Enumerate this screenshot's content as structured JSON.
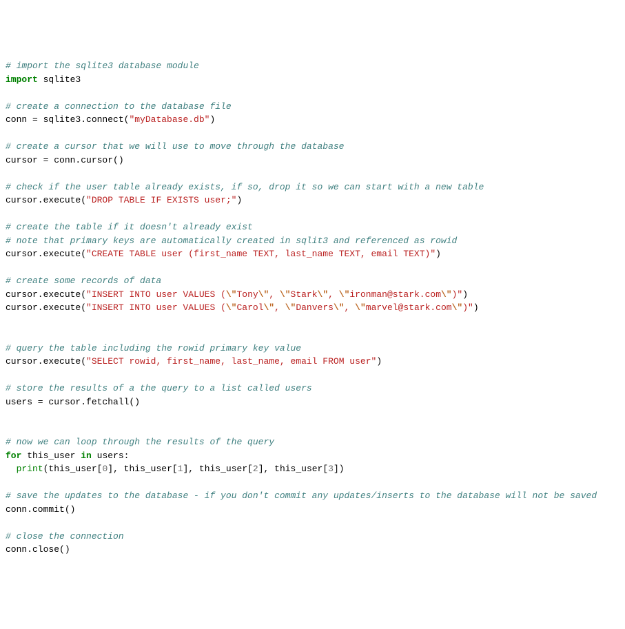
{
  "code": {
    "lines": [
      {
        "type": "comment",
        "text": "# import the sqlite3 database module"
      },
      {
        "type": "code",
        "tokens": [
          {
            "t": "keyword",
            "v": "import"
          },
          {
            "t": "name",
            "v": " sqlite3"
          }
        ]
      },
      {
        "type": "blank"
      },
      {
        "type": "comment",
        "text": "# create a connection to the database file"
      },
      {
        "type": "code",
        "tokens": [
          {
            "t": "name",
            "v": "conn = sqlite3.connect("
          },
          {
            "t": "string",
            "v": "\"myDatabase.db\""
          },
          {
            "t": "name",
            "v": ")"
          }
        ]
      },
      {
        "type": "blank"
      },
      {
        "type": "comment",
        "text": "# create a cursor that we will use to move through the database"
      },
      {
        "type": "code",
        "tokens": [
          {
            "t": "name",
            "v": "cursor = conn.cursor()"
          }
        ]
      },
      {
        "type": "blank"
      },
      {
        "type": "comment",
        "text": "# check if the user table already exists, if so, drop it so we can start with a new table"
      },
      {
        "type": "code",
        "tokens": [
          {
            "t": "name",
            "v": "cursor.execute("
          },
          {
            "t": "string",
            "v": "\"DROP TABLE IF EXISTS user;\""
          },
          {
            "t": "name",
            "v": ")"
          }
        ]
      },
      {
        "type": "blank"
      },
      {
        "type": "comment",
        "text": "# create the table if it doesn't already exist"
      },
      {
        "type": "comment",
        "text": "# note that primary keys are automatically created in sqlit3 and referenced as rowid"
      },
      {
        "type": "code",
        "tokens": [
          {
            "t": "name",
            "v": "cursor.execute("
          },
          {
            "t": "string",
            "v": "\"CREATE TABLE user (first_name TEXT, last_name TEXT, email TEXT)\""
          },
          {
            "t": "name",
            "v": ")"
          }
        ]
      },
      {
        "type": "blank"
      },
      {
        "type": "comment",
        "text": "# create some records of data"
      },
      {
        "type": "code",
        "tokens": [
          {
            "t": "name",
            "v": "cursor.execute("
          },
          {
            "t": "string",
            "v": "\"INSERT INTO user VALUES ("
          },
          {
            "t": "escape",
            "v": "\\\""
          },
          {
            "t": "string",
            "v": "Tony"
          },
          {
            "t": "escape",
            "v": "\\\""
          },
          {
            "t": "string",
            "v": ", "
          },
          {
            "t": "escape",
            "v": "\\\""
          },
          {
            "t": "string",
            "v": "Stark"
          },
          {
            "t": "escape",
            "v": "\\\""
          },
          {
            "t": "string",
            "v": ", "
          },
          {
            "t": "escape",
            "v": "\\\""
          },
          {
            "t": "string",
            "v": "ironman@stark.com"
          },
          {
            "t": "escape",
            "v": "\\\""
          },
          {
            "t": "string",
            "v": ")\""
          },
          {
            "t": "name",
            "v": ")"
          }
        ]
      },
      {
        "type": "code",
        "tokens": [
          {
            "t": "name",
            "v": "cursor.execute("
          },
          {
            "t": "string",
            "v": "\"INSERT INTO user VALUES ("
          },
          {
            "t": "escape",
            "v": "\\\""
          },
          {
            "t": "string",
            "v": "Carol"
          },
          {
            "t": "escape",
            "v": "\\\""
          },
          {
            "t": "string",
            "v": ", "
          },
          {
            "t": "escape",
            "v": "\\\""
          },
          {
            "t": "string",
            "v": "Danvers"
          },
          {
            "t": "escape",
            "v": "\\\""
          },
          {
            "t": "string",
            "v": ", "
          },
          {
            "t": "escape",
            "v": "\\\""
          },
          {
            "t": "string",
            "v": "marvel@stark.com"
          },
          {
            "t": "escape",
            "v": "\\\""
          },
          {
            "t": "string",
            "v": ")\""
          },
          {
            "t": "name",
            "v": ")"
          }
        ]
      },
      {
        "type": "blank"
      },
      {
        "type": "blank"
      },
      {
        "type": "comment",
        "text": "# query the table including the rowid primary key value"
      },
      {
        "type": "code",
        "tokens": [
          {
            "t": "name",
            "v": "cursor.execute("
          },
          {
            "t": "string",
            "v": "\"SELECT rowid, first_name, last_name, email FROM user\""
          },
          {
            "t": "name",
            "v": ")"
          }
        ]
      },
      {
        "type": "blank"
      },
      {
        "type": "comment",
        "text": "# store the results of a the query to a list called users"
      },
      {
        "type": "code",
        "tokens": [
          {
            "t": "name",
            "v": "users = cursor.fetchall()"
          }
        ]
      },
      {
        "type": "blank"
      },
      {
        "type": "blank"
      },
      {
        "type": "comment",
        "text": "# now we can loop through the results of the query"
      },
      {
        "type": "code",
        "tokens": [
          {
            "t": "keyword",
            "v": "for"
          },
          {
            "t": "name",
            "v": " this_user "
          },
          {
            "t": "keyword",
            "v": "in"
          },
          {
            "t": "name",
            "v": " users:"
          }
        ]
      },
      {
        "type": "code",
        "tokens": [
          {
            "t": "name",
            "v": "  "
          },
          {
            "t": "builtin",
            "v": "print"
          },
          {
            "t": "name",
            "v": "(this_user["
          },
          {
            "t": "number",
            "v": "0"
          },
          {
            "t": "name",
            "v": "], this_user["
          },
          {
            "t": "number",
            "v": "1"
          },
          {
            "t": "name",
            "v": "], this_user["
          },
          {
            "t": "number",
            "v": "2"
          },
          {
            "t": "name",
            "v": "], this_user["
          },
          {
            "t": "number",
            "v": "3"
          },
          {
            "t": "name",
            "v": "])"
          }
        ]
      },
      {
        "type": "blank"
      },
      {
        "type": "comment",
        "text": "# save the updates to the database - if you don't commit any updates/inserts to the database will not be saved"
      },
      {
        "type": "code",
        "tokens": [
          {
            "t": "name",
            "v": "conn.commit()"
          }
        ]
      },
      {
        "type": "blank"
      },
      {
        "type": "comment",
        "text": "# close the connection"
      },
      {
        "type": "code",
        "tokens": [
          {
            "t": "name",
            "v": "conn.close()"
          }
        ]
      }
    ]
  }
}
